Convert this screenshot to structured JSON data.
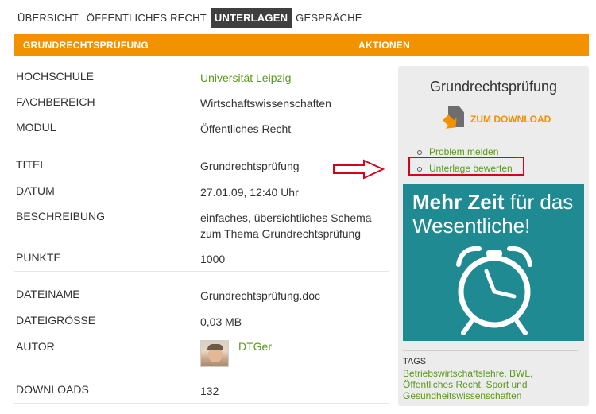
{
  "tabs": [
    {
      "label": "ÜBERSICHT"
    },
    {
      "label": "ÖFFENTLICHES RECHT"
    },
    {
      "label": "UNTERLAGEN"
    },
    {
      "label": "GESPRÄCHE"
    }
  ],
  "bar": {
    "left": "GRUNDRECHTSPRÜFUNG",
    "right": "AKTIONEN"
  },
  "details": {
    "hochschule": {
      "label": "HOCHSCHULE",
      "value": "Universität Leipzig"
    },
    "fachbereich": {
      "label": "FACHBEREICH",
      "value": "Wirtschaftswissenschaften"
    },
    "modul": {
      "label": "MODUL",
      "value": "Öffentliches Recht"
    },
    "titel": {
      "label": "TITEL",
      "value": "Grundrechtsprüfung"
    },
    "datum": {
      "label": "DATUM",
      "value": "27.01.09, 12:40 Uhr"
    },
    "beschreibung": {
      "label": "BESCHREIBUNG",
      "value": "einfaches, übersichtliches Schema zum Thema Grundrechtsprüfung"
    },
    "punkte": {
      "label": "PUNKTE",
      "value": "1000"
    },
    "dateiname": {
      "label": "DATEINAME",
      "value": "Grundrechtsprüfung.doc"
    },
    "dateigroesse": {
      "label": "DATEIGRÖSSE",
      "value": "0,03 MB"
    },
    "autor": {
      "label": "AUTOR",
      "value": "DTGer"
    },
    "downloads": {
      "label": "DOWNLOADS",
      "value": "132"
    }
  },
  "sidebar": {
    "title": "Grundrechtsprüfung",
    "download_label": "ZUM DOWNLOAD",
    "actions": [
      {
        "label": "Problem melden"
      },
      {
        "label": "Unterlage bewerten"
      }
    ],
    "ad": {
      "line1_bold": "Mehr Zeit",
      "line1_rest": " für das",
      "line2": "Wesentliche!"
    },
    "tags_title": "TAGS",
    "tags": "Betriebswirtschaftslehre, BWL, Öffentliches Recht, Sport und Gesundheitswissenschaften"
  },
  "colors": {
    "accent": "#f39200",
    "link": "#5a9a1c",
    "tab_active": "#3f3f3f",
    "highlight": "#d9001b",
    "ad_bg": "#1f8a92"
  },
  "icons": [
    "download-icon",
    "alarm-clock-icon",
    "red-arrow-icon",
    "avatar"
  ]
}
